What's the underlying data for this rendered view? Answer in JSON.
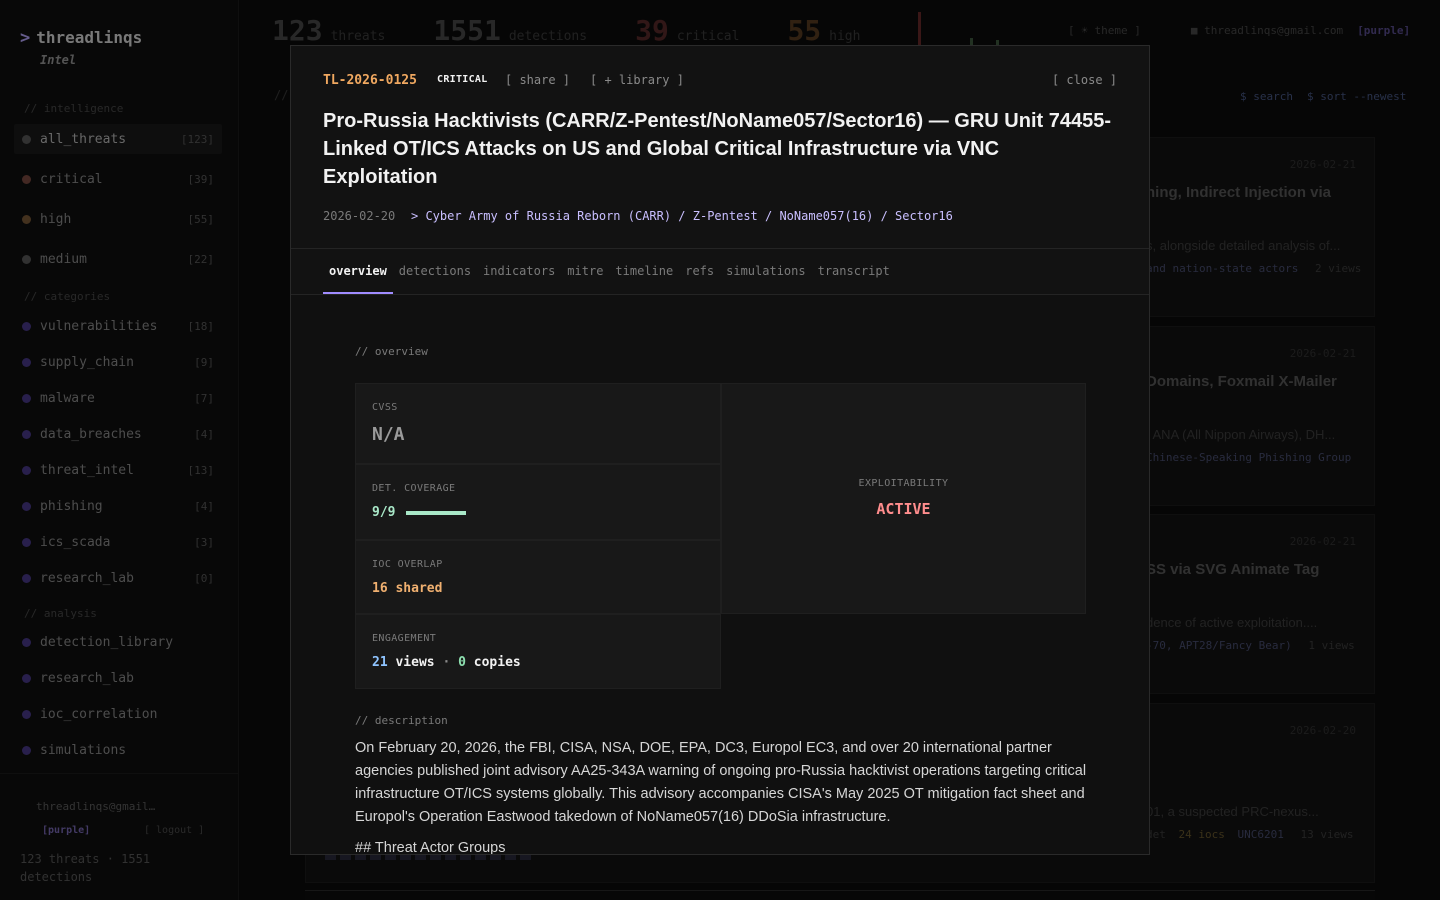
{
  "brand": {
    "prompt": ">",
    "name": "threadlinqs",
    "sub": "Intel"
  },
  "sidebar": {
    "sections": [
      {
        "label": "// intelligence"
      },
      {
        "label": "// categories"
      },
      {
        "label": "// analysis"
      }
    ],
    "items": [
      {
        "label": "all_threats",
        "count": "[123]",
        "color": "#5a5a5a"
      },
      {
        "label": "critical",
        "count": "[39]",
        "color": "#7a4a40"
      },
      {
        "label": "high",
        "count": "[55]",
        "color": "#7a5a38"
      },
      {
        "label": "medium",
        "count": "[22]",
        "color": "#5a5a5a"
      },
      {
        "label": "vulnerabilities",
        "count": "[18]",
        "color": "#4a3a8a"
      },
      {
        "label": "supply_chain",
        "count": "[9]",
        "color": "#4a3a8a"
      },
      {
        "label": "malware",
        "count": "[7]",
        "color": "#4a3a8a"
      },
      {
        "label": "data_breaches",
        "count": "[4]",
        "color": "#4a3a8a"
      },
      {
        "label": "threat_intel",
        "count": "[13]",
        "color": "#4a3a8a"
      },
      {
        "label": "phishing",
        "count": "[4]",
        "color": "#4a3a8a"
      },
      {
        "label": "ics_scada",
        "count": "[3]",
        "color": "#4a3a8a"
      },
      {
        "label": "research_lab",
        "count": "[0]",
        "color": "#4a3a8a"
      },
      {
        "label": "detection_library",
        "count": "",
        "color": "#4a3a8a"
      },
      {
        "label": "research_lab",
        "count": "",
        "color": "#4a3a8a"
      },
      {
        "label": "ioc_correlation",
        "count": "",
        "color": "#4a3a8a"
      },
      {
        "label": "simulations",
        "count": "",
        "color": "#4a3a8a"
      }
    ],
    "footer": {
      "email": "threadlinqs@gmail…",
      "plan": "[purple]",
      "logout": "[ logout ]",
      "stats": "123 threats · 1551 detections"
    }
  },
  "topstats": [
    {
      "num": "123",
      "label": "threats",
      "color": "#4a4a4a"
    },
    {
      "num": "1551",
      "label": "detections",
      "color": "#4a4a4a"
    },
    {
      "num": "39",
      "label": "critical",
      "color": "#5a2a2a"
    },
    {
      "num": "55",
      "label": "high",
      "color": "#5a3d22"
    }
  ],
  "topbar": {
    "theme": "[ ☀ theme ]",
    "email": "■ threadlinqs@gmail.com",
    "plan": "[purple]"
  },
  "bg_actions": {
    "search": "$ search",
    "sort": "$ sort --newest",
    "slash": "//"
  },
  "bg_cards": [
    {
      "date": "2026-02-21",
      "title": "hing, Indirect Injection via",
      "desc": "s, alongside detailed analysis of...",
      "actor": "and nation-state actors",
      "views": "2 views"
    },
    {
      "date": "2026-02-21",
      "title": "Domains, Foxmail X-Mailer",
      "desc": "f ANA (All Nippon Airways), DH...",
      "actor": "Chinese-Speaking Phishing Group",
      "views": ""
    },
    {
      "date": "2026-02-21",
      "title": "SS via SVG Animate Tag",
      "desc": "dence of active exploitation....",
      "actor": "-70, APT28/Fancy Bear)",
      "views": "1 views"
    },
    {
      "date": "2026-02-20",
      "title": "",
      "desc": "01, a suspected PRC-nexus...",
      "actor": "UNC6201",
      "views": "13 views",
      "det": "det",
      "iocs": "24 iocs"
    }
  ],
  "modal": {
    "id": "TL-2026-0125",
    "severity": "CRITICAL",
    "share": "[ share ]",
    "library": "[ + library ]",
    "close": "[ close ]",
    "title": "Pro-Russia Hacktivists (CARR/Z-Pentest/NoName057/Sector16) — GRU Unit 74455-Linked OT/ICS Attacks on US and Global Critical Infrastructure via VNC Exploitation",
    "date": "2026-02-20",
    "actors": "> Cyber Army of Russia Reborn (CARR) / Z-Pentest / NoName057(16) / Sector16",
    "tabs": [
      "overview",
      "detections",
      "indicators",
      "mitre",
      "timeline",
      "refs",
      "simulations",
      "transcript"
    ],
    "overview": {
      "section": "// overview",
      "cvss_label": "CVSS",
      "cvss_value": "N/A",
      "coverage_label": "DET. COVERAGE",
      "coverage_value": "9/9",
      "coverage_fraction": 1.0,
      "ioc_label": "IOC OVERLAP",
      "ioc_value": "16 shared",
      "engagement_label": "ENGAGEMENT",
      "views": "21",
      "views_label": "views",
      "sep": "·",
      "copies": "0",
      "copies_label": "copies",
      "exploitability_label": "EXPLOITABILITY",
      "exploitability_value": "ACTIVE"
    },
    "description": {
      "section": "// description",
      "text": "On February 20, 2026, the FBI, CISA, NSA, DOE, EPA, DC3, Europol EC3, and over 20 international partner agencies published joint advisory AA25-343A warning of ongoing pro-Russia hacktivist operations targeting critical infrastructure OT/ICS systems globally. This advisory accompanies CISA's May 2025 OT mitigation fact sheet and Europol's Operation Eastwood takedown of NoName057(16) DDoSia infrastructure.",
      "next_heading": "## Threat Actor Groups"
    }
  }
}
